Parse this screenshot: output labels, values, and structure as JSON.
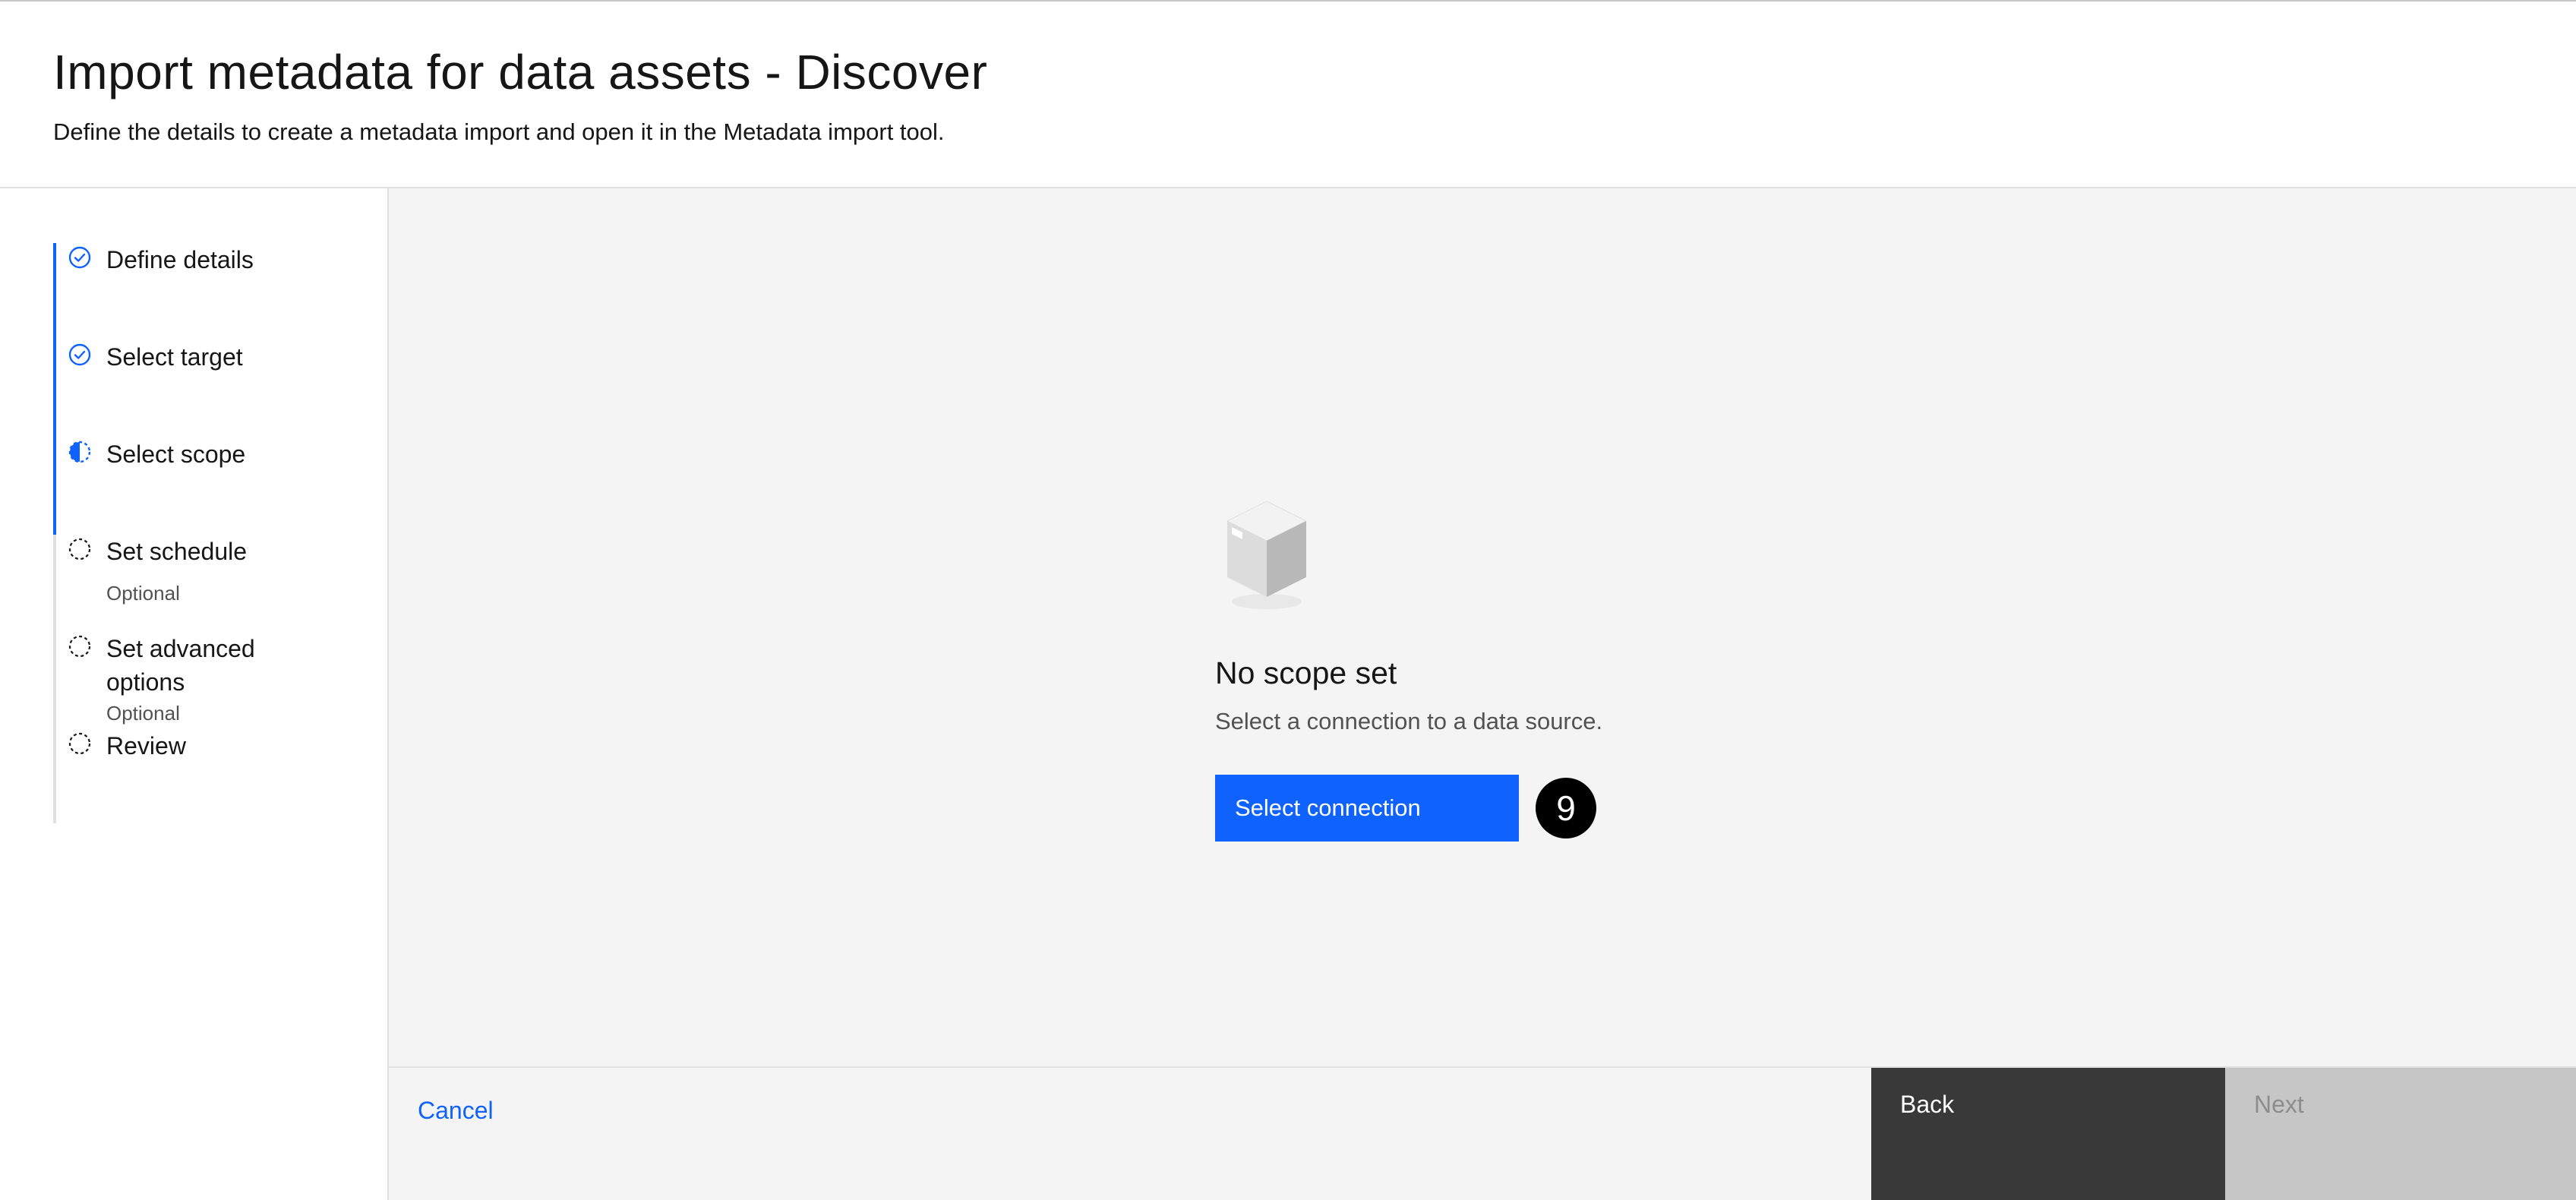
{
  "header": {
    "title": "Import metadata for data assets - Discover",
    "subtitle": "Define the details to create a metadata import and open it in the Metadata import tool."
  },
  "steps": [
    {
      "label": "Define details",
      "status": "complete"
    },
    {
      "label": "Select target",
      "status": "complete"
    },
    {
      "label": "Select scope",
      "status": "current"
    },
    {
      "label": "Set schedule",
      "status": "incomplete",
      "optional": "Optional"
    },
    {
      "label": "Set advanced options",
      "label_line1": "Set advanced",
      "label_line2": "options",
      "status": "incomplete",
      "optional": "Optional"
    },
    {
      "label": "Review",
      "status": "incomplete"
    }
  ],
  "empty_state": {
    "illustration": "box-icon",
    "title": "No scope set",
    "description": "Select a connection to a data source.",
    "action_label": "Select connection",
    "badge": "9"
  },
  "footer": {
    "cancel_label": "Cancel",
    "back_label": "Back",
    "next_label": "Next"
  },
  "colors": {
    "accent": "#0f62fe",
    "back_button": "#393939",
    "next_disabled": "#c6c6c6"
  }
}
